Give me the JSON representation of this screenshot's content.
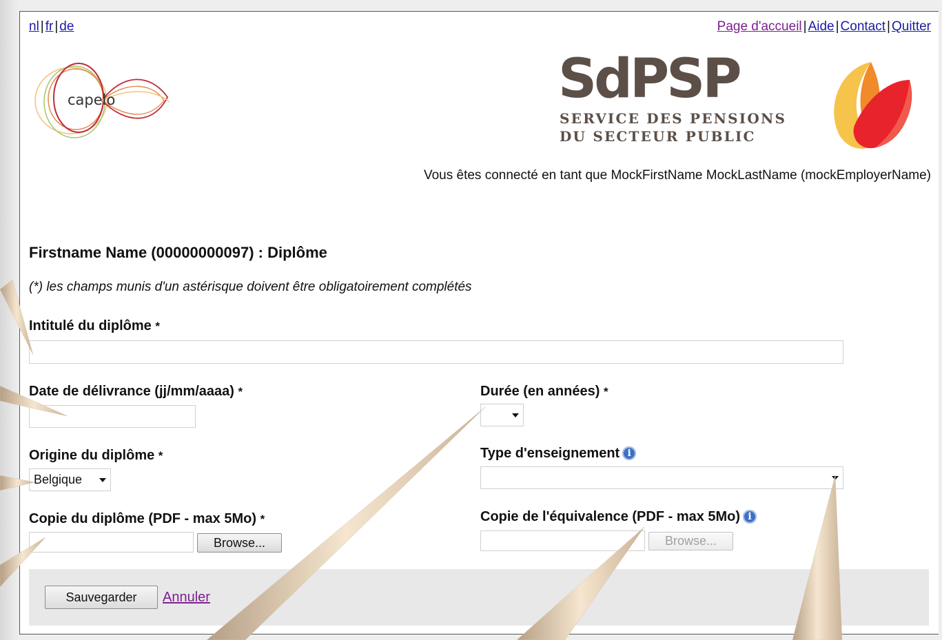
{
  "language_links": [
    "nl",
    "fr",
    "de"
  ],
  "top_nav": [
    "Page d'accueil",
    "Aide",
    "Contact",
    "Quitter"
  ],
  "logos": {
    "capelo_text": "capelo",
    "org_acronym": "SdPSP",
    "org_name_line1": "SERVICE DES PENSIONS",
    "org_name_line2": "DU SECTEUR PUBLIC"
  },
  "logged_in_text": "Vous êtes connecté en tant que MockFirstName MockLastName (mockEmployerName)",
  "page_title": "Firstname Name (00000000097) : Diplôme",
  "required_note": "(*) les champs munis d'un astérisque doivent être obligatoirement complétés",
  "form": {
    "required_marker": "*",
    "diploma_title": {
      "label": "Intitulé du diplôme",
      "value": ""
    },
    "issue_date": {
      "label": "Date de délivrance (jj/mm/aaaa)",
      "value": ""
    },
    "duration": {
      "label": "Durée (en années)",
      "selected": ""
    },
    "origin": {
      "label": "Origine du diplôme",
      "selected": "Belgique"
    },
    "education_type": {
      "label": "Type d'enseignement",
      "selected": ""
    },
    "diploma_copy": {
      "label": "Copie du diplôme (PDF - max 5Mo)",
      "button": "Browse..."
    },
    "equivalence_copy": {
      "label": "Copie de l'équivalence (PDF - max 5Mo)",
      "button": "Browse..."
    }
  },
  "actions": {
    "save": "Sauvegarder",
    "cancel": "Annuler"
  },
  "icons": [
    "info-icon",
    "capelo-logo",
    "sdpsp-logo-mark"
  ],
  "colors": {
    "link": "#1a1aa6",
    "visited_link": "#7b1f8f",
    "info_icon": "#3f6fc4",
    "logo_text": "#5b4f47"
  }
}
